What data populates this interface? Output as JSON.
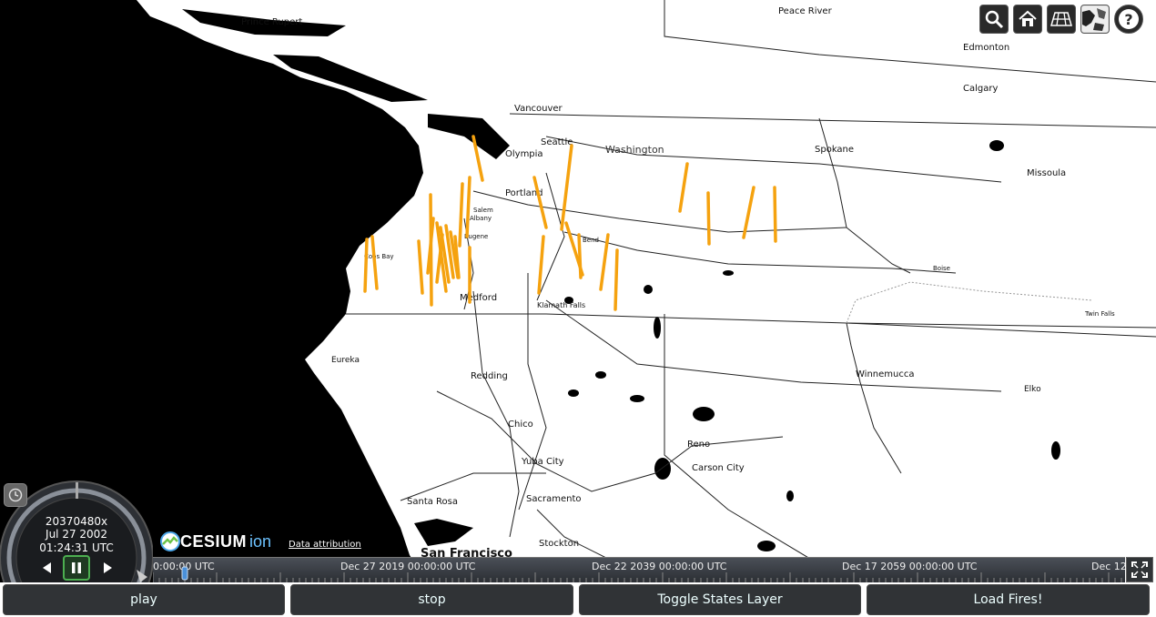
{
  "toolbar": {
    "icons": [
      "search-icon",
      "home-icon",
      "projection-grid-icon",
      "base-layer-picker-icon",
      "help-icon"
    ],
    "help_label": "?"
  },
  "map": {
    "labels": {
      "prince_rupert": "Prince Rupert",
      "peace_river": "Peace River",
      "edmonton": "Edmonton",
      "calgary": "Calgary",
      "vancouver": "Vancouver",
      "seattle": "Seattle",
      "washington": "Washington",
      "olympia": "Olympia",
      "spokane": "Spokane",
      "missoula": "Missoula",
      "portland": "Portland",
      "salem": "Salem",
      "albany": "Albany",
      "eugene": "Eugene",
      "bend": "Bend",
      "coos_bay": "Coos Bay",
      "medford": "Medford",
      "klamath_falls": "Klamath Falls",
      "boise": "Boise",
      "twin_falls": "Twin Falls",
      "eureka": "Eureka",
      "redding": "Redding",
      "winnemucca": "Winnemucca",
      "elko": "Elko",
      "chico": "Chico",
      "reno": "Reno",
      "carson_city": "Carson City",
      "yuba_city": "Yuba City",
      "santa_rosa": "Santa Rosa",
      "sacramento": "Sacramento",
      "stockton": "Stockton",
      "san_francisco": "San Francisco"
    },
    "fire_marker_color": "#f5a20f"
  },
  "animation": {
    "speed": "20370480x",
    "date": "Jul 27 2002",
    "time": "01:24:31 UTC",
    "state": "paused",
    "icons": [
      "clock-icon",
      "play-reverse-icon",
      "pause-icon",
      "play-forward-icon"
    ]
  },
  "branding": {
    "logo_word": "CESIUM",
    "logo_suffix": "ion",
    "attribution": "Data attribution"
  },
  "timeline": {
    "labels": [
      "0:00:00 UTC",
      "Dec 27 2019 00:00:00 UTC",
      "Dec 22 2039 00:00:00 UTC",
      "Dec 17 2059 00:00:00 UTC",
      "Dec 12"
    ]
  },
  "buttons": {
    "play": "play",
    "stop": "stop",
    "toggle_states": "Toggle States Layer",
    "load_fires": "Load Fires!"
  }
}
